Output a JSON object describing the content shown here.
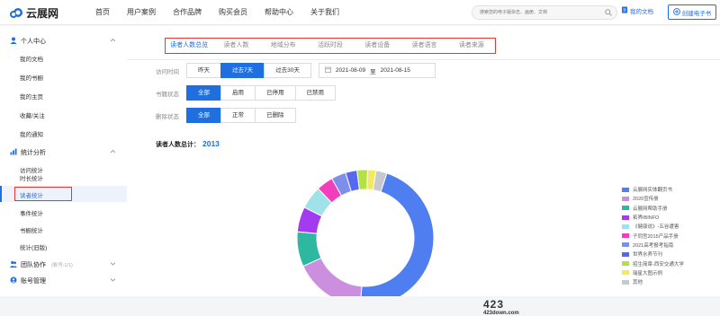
{
  "header": {
    "logo_text": "云展网",
    "nav": [
      "首页",
      "用户案例",
      "合作品牌",
      "购买会员",
      "帮助中心",
      "关于我们"
    ],
    "search_placeholder": "搜索您的电子版杂志、画册、文档",
    "my_docs_label": "我的文档",
    "create_label": "创建电子书",
    "brand_color": "#1f6fe0"
  },
  "sidebar": {
    "groups": [
      {
        "label": "个人中心",
        "icon": "user-icon",
        "items": [
          "我的文档",
          "我的书橱",
          "我的主页",
          "收藏/关注",
          "我的通知"
        ]
      },
      {
        "label": "统计分析",
        "icon": "chart-icon",
        "items": [
          "访问统计",
          "时长统计",
          "读者统计",
          "事件统计",
          "书橱统计",
          "统计(旧版)"
        ]
      },
      {
        "label": "团队协作",
        "note": "(账号:1/1)",
        "icon": "team-icon",
        "items": []
      },
      {
        "label": "账号管理",
        "icon": "account-icon",
        "items": []
      }
    ],
    "active_item": "读者统计"
  },
  "tabs": [
    "读者人数总览",
    "读者人数",
    "地域分布",
    "活跃时段",
    "读者设备",
    "读者语言",
    "读者来源"
  ],
  "active_tab": "读者人数总览",
  "filters": {
    "time": {
      "label": "访问时间",
      "options": [
        "昨天",
        "过去7天",
        "过去30天"
      ],
      "selected": "过去7天",
      "date_from": "2021-08-09",
      "date_sep": "至",
      "date_to": "2021-08-15"
    },
    "shelf": {
      "label": "书籍状态",
      "options": [
        "全部",
        "启用",
        "已停用",
        "已禁用"
      ],
      "selected": "全部"
    },
    "deleted": {
      "label": "删除状态",
      "options": [
        "全部",
        "正常",
        "已删除"
      ],
      "selected": "全部"
    }
  },
  "total": {
    "label": "读者人数总计：",
    "value": "2013"
  },
  "chart_data": {
    "type": "pie",
    "title": "",
    "categories": [
      "云展网实体翻页书",
      "2020宣传册",
      "云展网帮助手册",
      "拓界IBINFO",
      "《健康说》-五谷遭害",
      "子同宫2015产品手册",
      "2021高考报考指南",
      "世界水养节刊",
      "招生简章-西安交通大学",
      "瑞星大图示例",
      "其他"
    ],
    "values": [
      928,
      342,
      166,
      120,
      110,
      80,
      70,
      55,
      50,
      40,
      52
    ],
    "colors": [
      "#4e7ef0",
      "#cc8fe0",
      "#2fb8a1",
      "#a43bf0",
      "#9fe3e8",
      "#f23ebc",
      "#7d8fe8",
      "#5568f2",
      "#b3e043",
      "#f5e85a",
      "#c7c9cf"
    ]
  },
  "watermark": {
    "line1": "423",
    "line2": "423down.com"
  }
}
